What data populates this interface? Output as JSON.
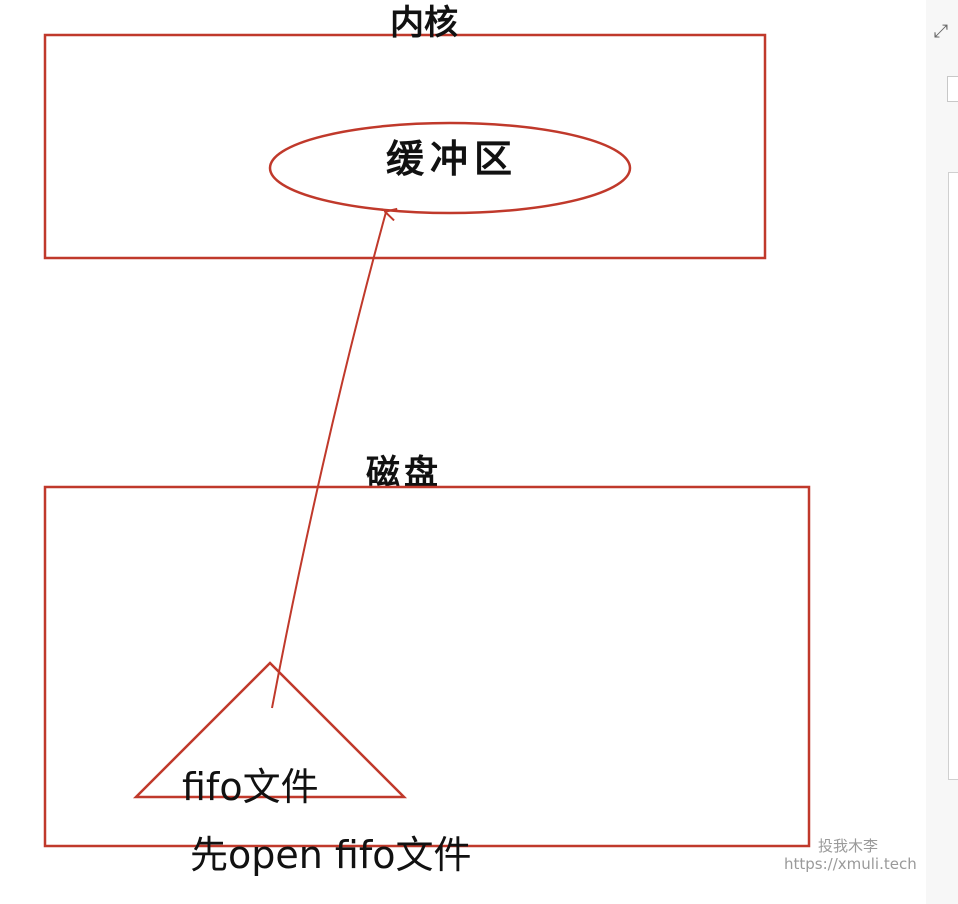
{
  "diagram": {
    "kernel_label": "内核",
    "buffer_label": "缓冲区",
    "disk_label": "磁盘",
    "fifo_file_label": "fifo文件",
    "open_note": "先open fifo文件"
  },
  "watermark": {
    "line1": "投我木李",
    "line2": "https://xmuli.tech"
  },
  "side_panel": {
    "expand_icon": "⤢"
  },
  "colors": {
    "stroke": "#c0392b",
    "text": "#111111",
    "watermark": "#9a9a9a"
  }
}
